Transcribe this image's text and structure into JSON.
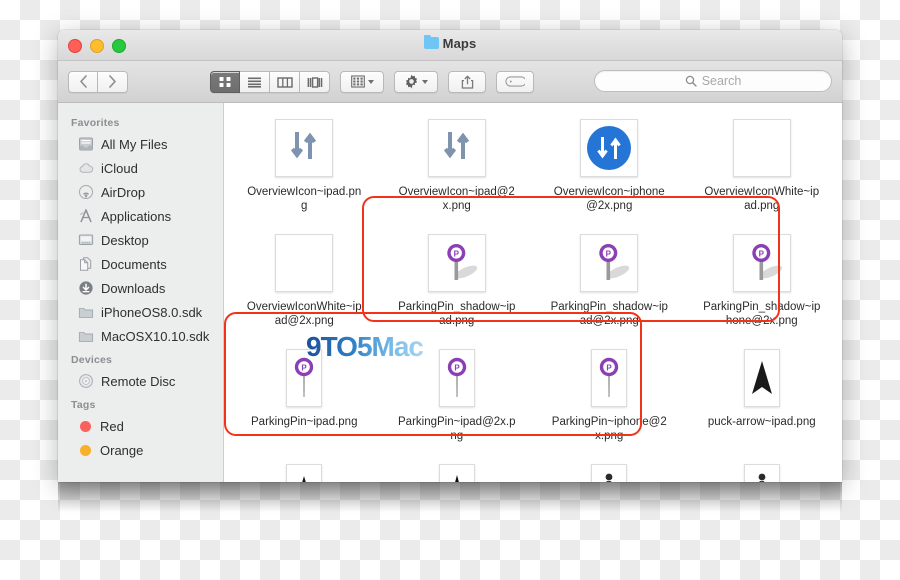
{
  "window": {
    "title": "Maps",
    "title_icon": "blue-folder-icon",
    "traffic_lights": [
      {
        "name": "close-button",
        "color": "#ff5f57"
      },
      {
        "name": "minimize-button",
        "color": "#febc2e"
      },
      {
        "name": "maximize-button",
        "color": "#28c840"
      }
    ]
  },
  "toolbar": {
    "back_label": "‹",
    "forward_label": "›",
    "view_buttons": [
      {
        "name": "icon-view-button",
        "icon": "grid-icon",
        "active": true
      },
      {
        "name": "list-view-button",
        "icon": "list-icon",
        "active": false
      },
      {
        "name": "column-view-button",
        "icon": "columns-icon",
        "active": false
      },
      {
        "name": "coverflow-view-button",
        "icon": "coverflow-icon",
        "active": false
      }
    ],
    "arrange_button": {
      "name": "arrange-button",
      "icon": "arrange-grid-icon"
    },
    "action_button": {
      "name": "action-button",
      "icon": "gear-icon"
    },
    "share_button": {
      "name": "share-button",
      "icon": "share-icon"
    },
    "tag_button": {
      "name": "tag-button",
      "icon": "tag-icon"
    }
  },
  "search": {
    "placeholder": "Search",
    "value": "",
    "icon": "search-icon"
  },
  "sidebar": {
    "sections": [
      {
        "header": "Favorites",
        "items": [
          {
            "label": "All My Files",
            "icon": "all-my-files-icon"
          },
          {
            "label": "iCloud",
            "icon": "cloud-icon"
          },
          {
            "label": "AirDrop",
            "icon": "airdrop-icon"
          },
          {
            "label": "Applications",
            "icon": "applications-icon"
          },
          {
            "label": "Desktop",
            "icon": "desktop-icon"
          },
          {
            "label": "Documents",
            "icon": "documents-icon"
          },
          {
            "label": "Downloads",
            "icon": "downloads-icon"
          },
          {
            "label": "iPhoneOS8.0.sdk",
            "icon": "folder-icon"
          },
          {
            "label": "MacOSX10.10.sdk",
            "icon": "folder-icon"
          }
        ]
      },
      {
        "header": "Devices",
        "items": [
          {
            "label": "Remote Disc",
            "icon": "disc-icon"
          }
        ]
      },
      {
        "header": "Tags",
        "items": [
          {
            "label": "Red",
            "icon": "tag-dot",
            "color": "#f9615f"
          },
          {
            "label": "Orange",
            "icon": "tag-dot",
            "color": "#f6b02c"
          }
        ]
      }
    ]
  },
  "files": [
    {
      "name": "OverviewIcon~ipad.png",
      "thumb": "overview-arrows-gray",
      "shape": "square"
    },
    {
      "name": "OverviewIcon~ipad@2x.png",
      "thumb": "overview-arrows-gray",
      "shape": "square"
    },
    {
      "name": "OverviewIcon~iphone@2x.png",
      "thumb": "overview-arrows-blue-circle",
      "shape": "square"
    },
    {
      "name": "OverviewIconWhite~ipad.png",
      "thumb": "blank-white",
      "shape": "square"
    },
    {
      "name": "OverviewIconWhite~ipad@2x.png",
      "thumb": "blank-white",
      "shape": "square"
    },
    {
      "name": "ParkingPin_shadow~ipad.png",
      "thumb": "parking-pin-shadow",
      "shape": "square"
    },
    {
      "name": "ParkingPin_shadow~ipad@2x.png",
      "thumb": "parking-pin-shadow",
      "shape": "square"
    },
    {
      "name": "ParkingPin_shadow~iphone@2x.png",
      "thumb": "parking-pin-shadow",
      "shape": "square"
    },
    {
      "name": "ParkingPin~ipad.png",
      "thumb": "parking-pin",
      "shape": "tall"
    },
    {
      "name": "ParkingPin~ipad@2x.png",
      "thumb": "parking-pin",
      "shape": "tall"
    },
    {
      "name": "ParkingPin~iphone@2x.png",
      "thumb": "parking-pin",
      "shape": "tall"
    },
    {
      "name": "puck-arrow~ipad.png",
      "thumb": "puck-arrow",
      "shape": "tall"
    },
    {
      "name": "",
      "thumb": "puck-arrow",
      "shape": "tall"
    },
    {
      "name": "",
      "thumb": "puck-arrow",
      "shape": "tall"
    },
    {
      "name": "",
      "thumb": "walking-person",
      "shape": "tall"
    },
    {
      "name": "",
      "thumb": "walking-person",
      "shape": "tall"
    }
  ],
  "annotations": [
    {
      "name": "highlight-parkingpin-shadow-row",
      "color": "#f3321a"
    },
    {
      "name": "highlight-parkingpin-row",
      "color": "#f3321a"
    }
  ],
  "watermark": {
    "text": "9T⊙ 5Mac",
    "text_plain": "9TO5Mac"
  },
  "colors": {
    "accent_blue": "#1f74d8",
    "pin_purple": "#8b3fb5",
    "annotation_red": "#f3321a"
  }
}
